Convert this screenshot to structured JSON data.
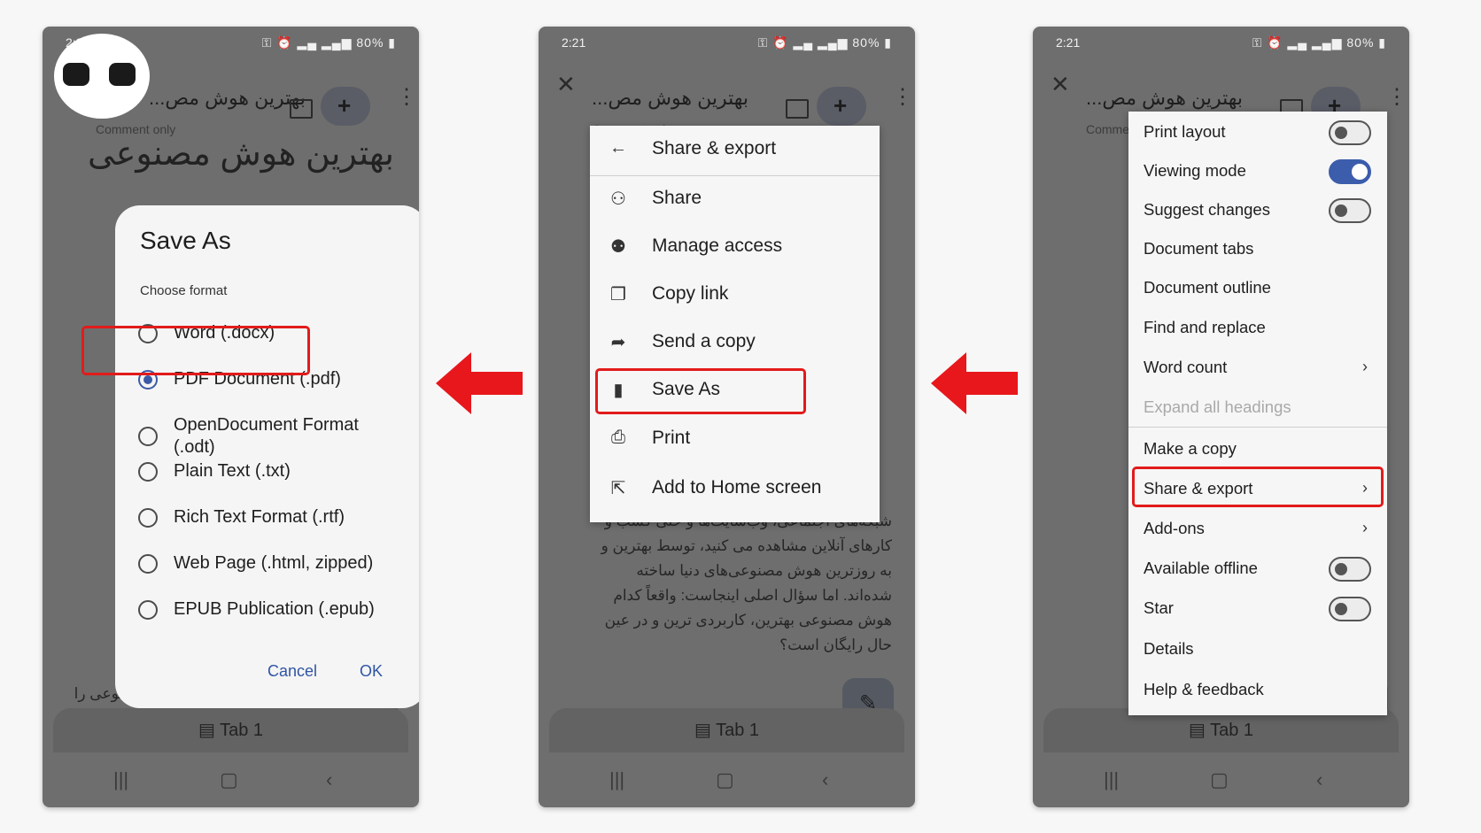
{
  "status": {
    "time": "2:21",
    "battery": "80%"
  },
  "document": {
    "title": "بهترین هوش مص...",
    "subtitle": "Comment only"
  },
  "phone1": {
    "dialog": {
      "title": "Save As",
      "choose_label": "Choose format",
      "options": [
        "Word (.docx)",
        "PDF Document (.pdf)",
        "OpenDocument Format (.odt)",
        "Plain Text (.txt)",
        "Rich Text Format (.rtf)",
        "Web Page (.html, zipped)",
        "EPUB Publication (.epub)"
      ],
      "selected": "PDF Document (.pdf)",
      "cancel": "Cancel",
      "ok": "OK"
    },
    "bottom_text": "ی قوی ترین ابزارهای هوش مصنوعی را"
  },
  "phone2": {
    "menu_header": "Share & export",
    "menu_items": [
      "Share",
      "Manage access",
      "Copy link",
      "Send a copy",
      "Save As",
      "Print",
      "Add to Home screen"
    ],
    "bg_lines": [
      "شبکه‌های اجتماعی، وب‌سایت‌ها و حتی کسب و",
      "کارهای آنلاین مشاهده می کنید، توسط بهترین و",
      "به روزترین هوش مصنوعی‌های دنیا ساخته",
      "شده‌اند. اما سؤال اصلی اینجاست: واقعاً کدام",
      "هوش مصنوعی بهترین، کاربردی  ترین و در عین",
      "حال رایگان است؟"
    ]
  },
  "phone3": {
    "menu_items": [
      {
        "label": "Print layout",
        "toggle": "off"
      },
      {
        "label": "Viewing mode",
        "toggle": "on"
      },
      {
        "label": "Suggest changes",
        "toggle": "off"
      },
      {
        "label": "Document tabs"
      },
      {
        "label": "Document outline"
      },
      {
        "label": "Find and replace"
      },
      {
        "label": "Word count",
        "chevron": true
      },
      {
        "label": "Expand all headings",
        "disabled": true
      },
      {
        "label": "Make a copy"
      },
      {
        "label": "Share & export",
        "chevron": true
      },
      {
        "label": "Add-ons",
        "chevron": true
      },
      {
        "label": "Available offline",
        "toggle": "off"
      },
      {
        "label": "Star",
        "toggle": "off"
      },
      {
        "label": "Details"
      },
      {
        "label": "Help & feedback"
      }
    ]
  },
  "tab_label": "Tab 1",
  "colors": {
    "highlight": "#e21b1b",
    "accent": "#3c5dab"
  }
}
